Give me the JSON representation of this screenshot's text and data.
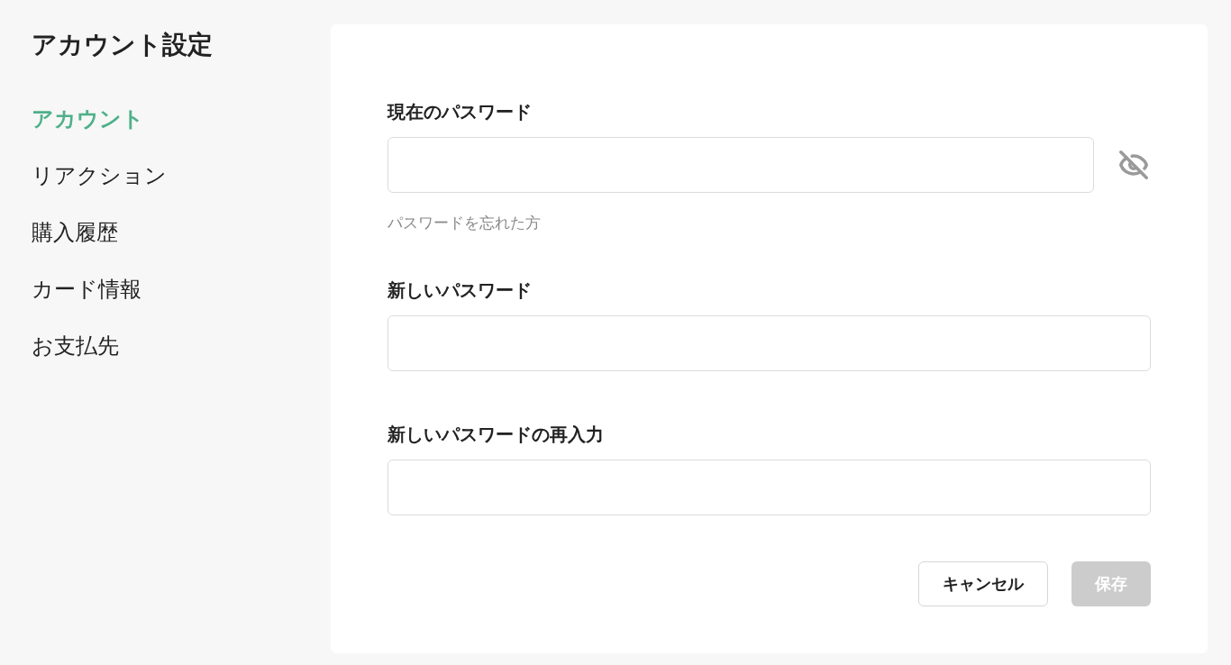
{
  "sidebar": {
    "title": "アカウント設定",
    "items": [
      {
        "label": "アカウント",
        "selected": true
      },
      {
        "label": "リアクション",
        "selected": false
      },
      {
        "label": "購入履歴",
        "selected": false
      },
      {
        "label": "カード情報",
        "selected": false
      },
      {
        "label": "お支払先",
        "selected": false
      }
    ]
  },
  "form": {
    "fields": [
      {
        "label": "現在のパスワード",
        "password_visible": false,
        "link": "パスワードを忘れた方"
      },
      {
        "label": "新しいパスワード"
      },
      {
        "label": "新しいパスワードの再入力"
      }
    ],
    "buttons": [
      {
        "label": "キャンセル",
        "kind": "secondary",
        "disabled": false
      },
      {
        "label": "保存",
        "kind": "primary",
        "disabled": true
      }
    ]
  }
}
